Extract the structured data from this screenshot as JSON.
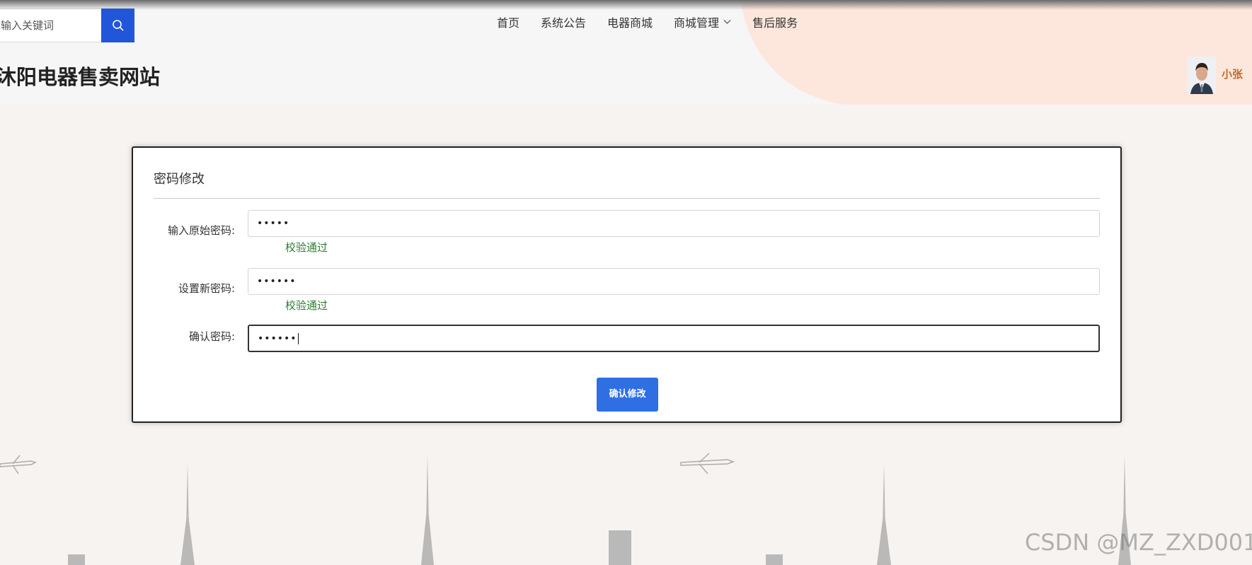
{
  "header": {
    "search": {
      "placeholder": "输入关键词"
    },
    "nav": [
      "首页",
      "系统公告",
      "电器商城",
      "商城管理",
      "售后服务"
    ],
    "site_title": "沐阳电器售卖网站",
    "user": {
      "name": "小张"
    }
  },
  "form": {
    "title": "密码修改",
    "fields": [
      {
        "label": "输入原始密码:",
        "value": "•••••",
        "hint": "校验通过"
      },
      {
        "label": "设置新密码:",
        "value": "••••••",
        "hint": "校验通过"
      },
      {
        "label": "确认密码:",
        "value": "••••••",
        "hint": ""
      }
    ],
    "submit_label": "确认修改"
  },
  "watermark": "CSDN @MZ_ZXD001",
  "colors": {
    "primary": "#2156d9",
    "button": "#2f6fe4",
    "success": "#2e7d32",
    "username": "#c06a2a",
    "peach": "#fde7dc"
  },
  "icons": [
    "search-icon",
    "chevron-down-icon",
    "avatar-photo",
    "airplane-icon",
    "tower-icon"
  ]
}
